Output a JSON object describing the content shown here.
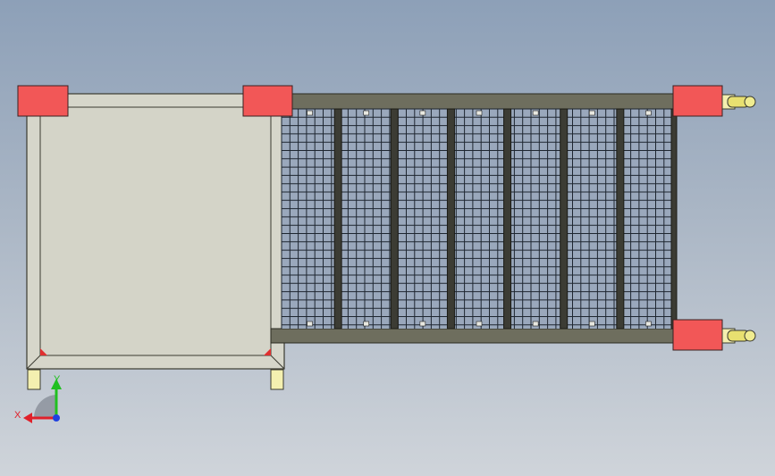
{
  "viewport": {
    "background_top": "#8da0b8",
    "background_bottom": "#cfd4da"
  },
  "model": {
    "frame_color": "#d6d6ca",
    "frame_stroke": "#3a3a30",
    "rail_color": "#6e6e5e",
    "mesh_color": "#1e2630",
    "mesh_panel_bg": "#9aa8bc",
    "corner_block_color": "#f25757",
    "leg_color": "#f4f0b0",
    "pin_color": "#e8e070",
    "panel_count": 7
  },
  "triad": {
    "x_label": "X",
    "y_label": "Y",
    "x_color": "#e0202a",
    "y_color": "#20c020",
    "z_color": "#2040e0"
  }
}
